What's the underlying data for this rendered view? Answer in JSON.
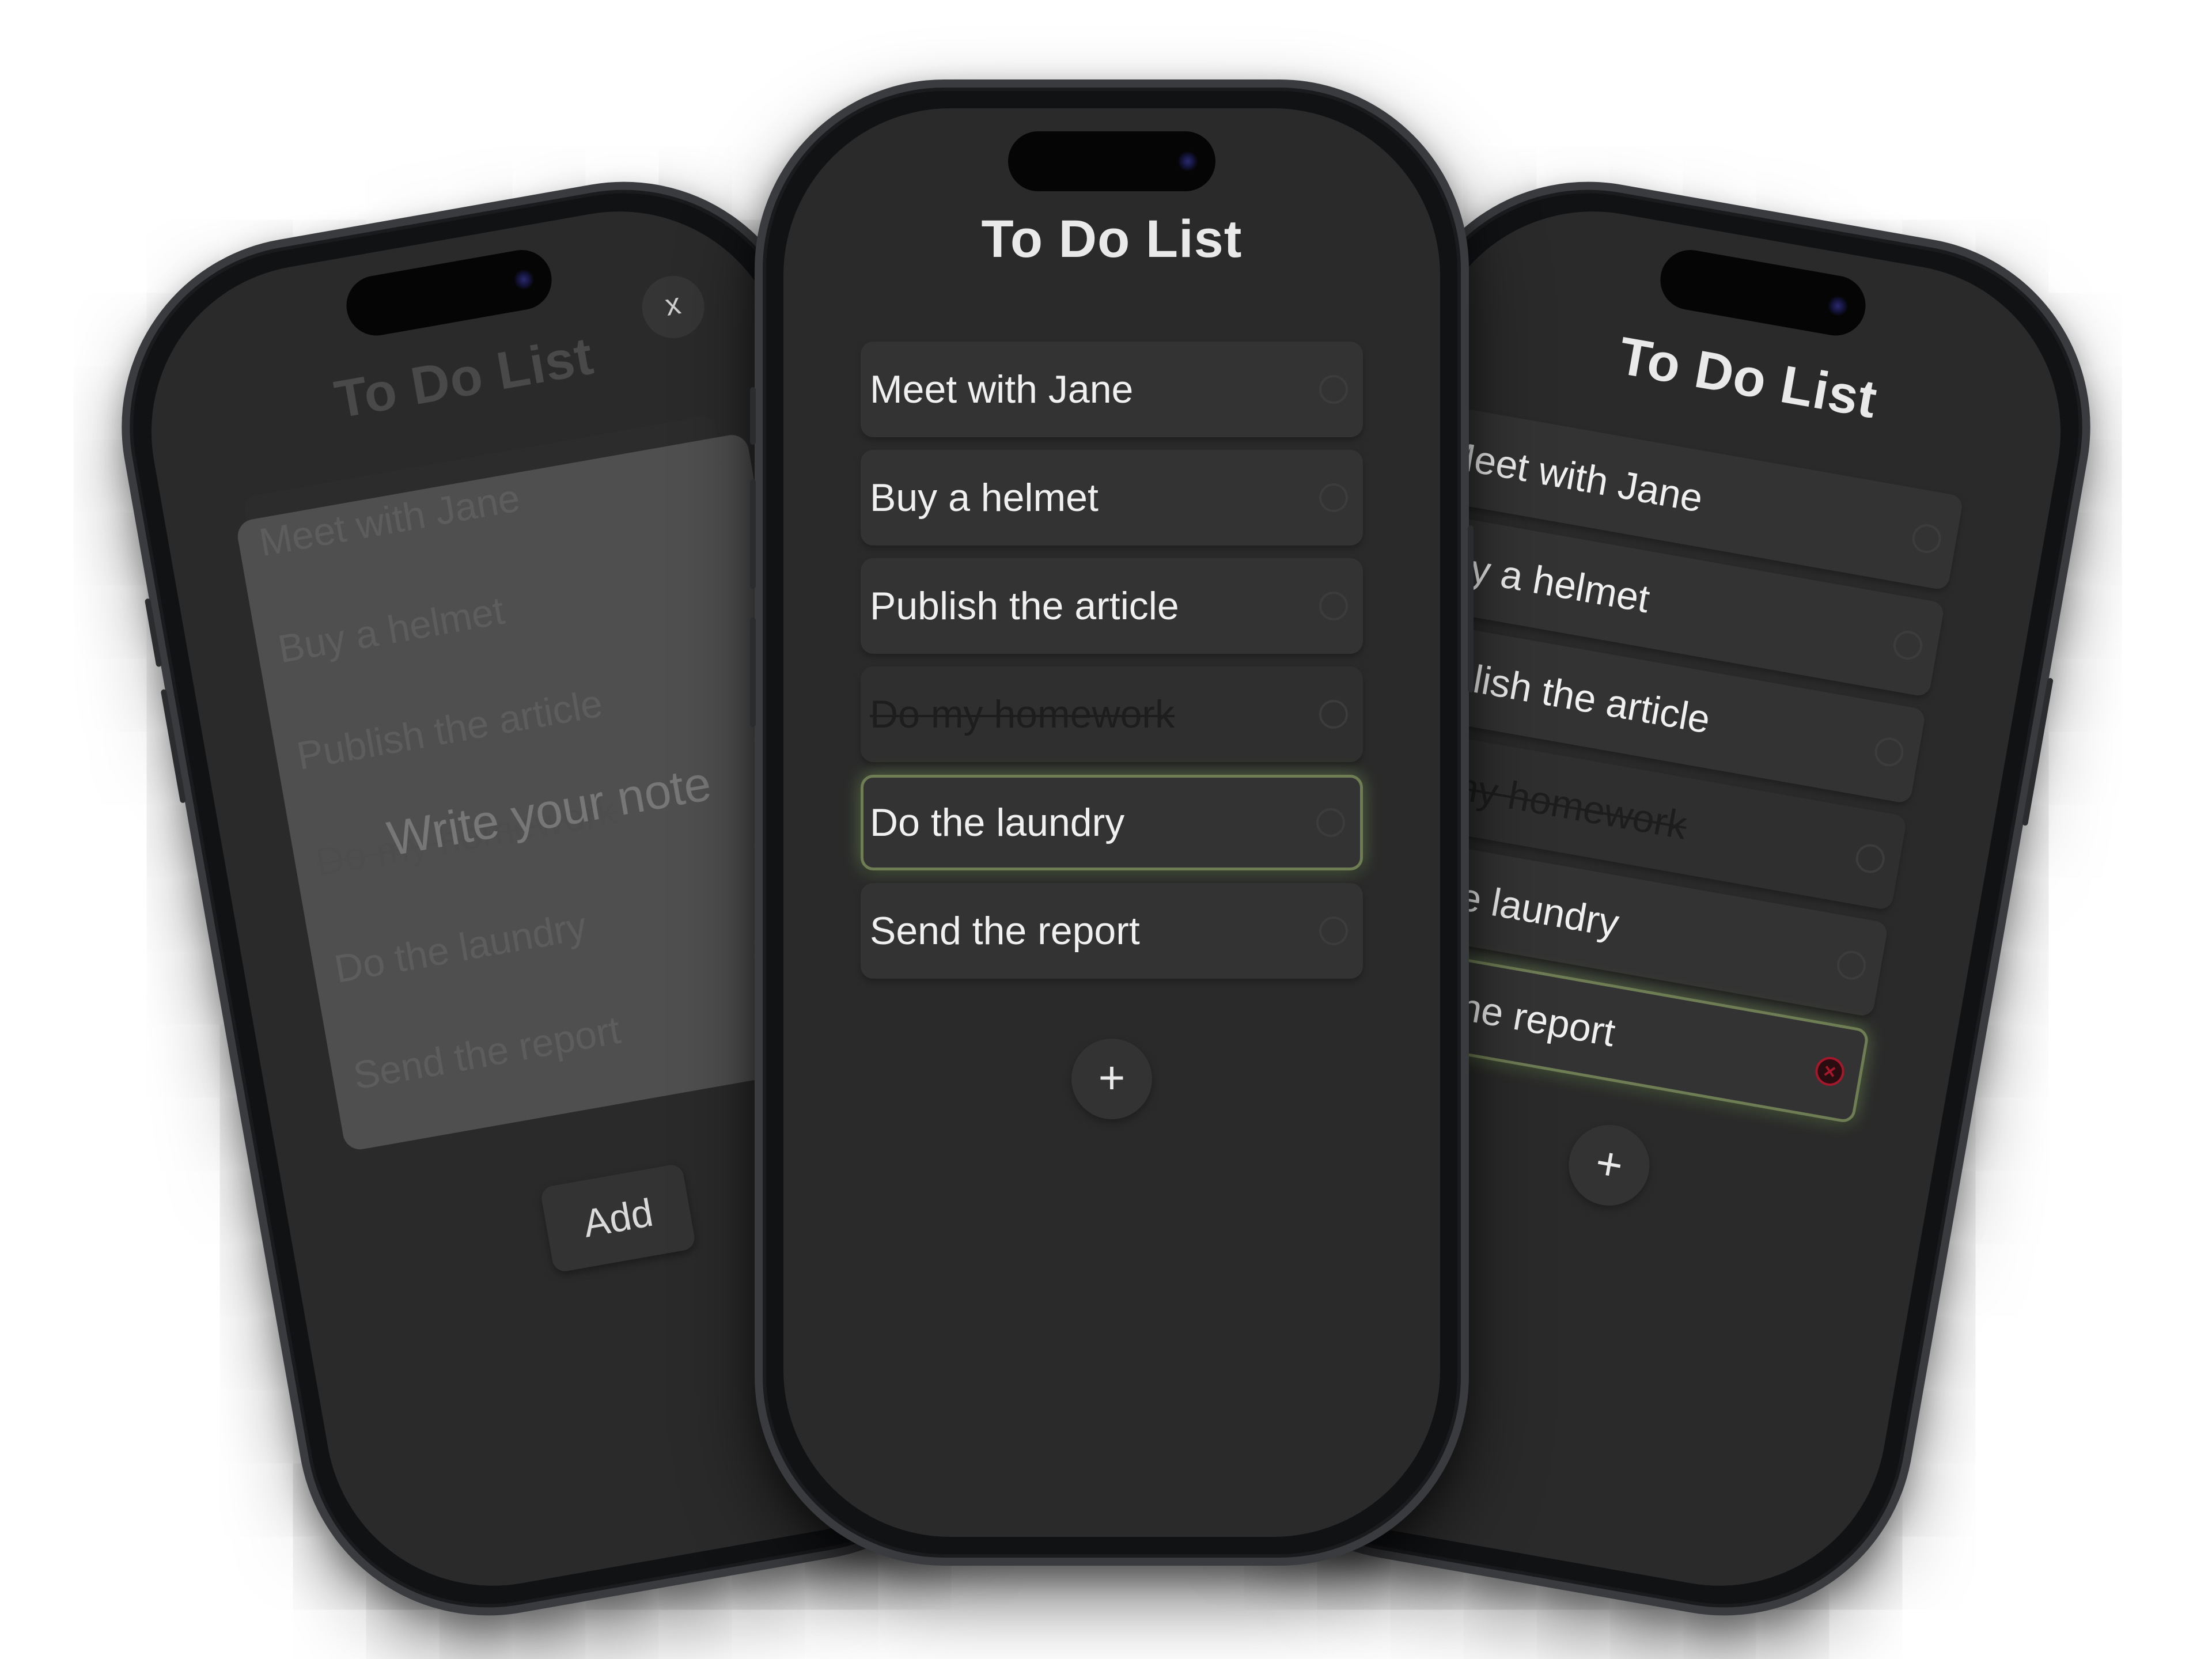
{
  "app": {
    "title": "To Do List",
    "add_symbol": "+"
  },
  "tasks": [
    {
      "label": "Meet with Jane",
      "done": false
    },
    {
      "label": "Buy a helmet",
      "done": false
    },
    {
      "label": "Publish the article",
      "done": false
    },
    {
      "label": "Do my homework",
      "done": true
    },
    {
      "label": "Do the laundry",
      "done": false
    },
    {
      "label": "Send the report",
      "done": false
    }
  ],
  "modal": {
    "close_label": "x",
    "note_placeholder": "Write your note",
    "add_label": "Add"
  },
  "icons": {
    "task_check": "circle-icon",
    "task_delete": "delete-x-icon",
    "delete_color": "#a3182a",
    "active_glow_color": "#6f7d55"
  },
  "colors": {
    "background": "#ffffff",
    "screen": "#2a2a2a",
    "card": "#333333",
    "text": "#f0f0f0"
  }
}
